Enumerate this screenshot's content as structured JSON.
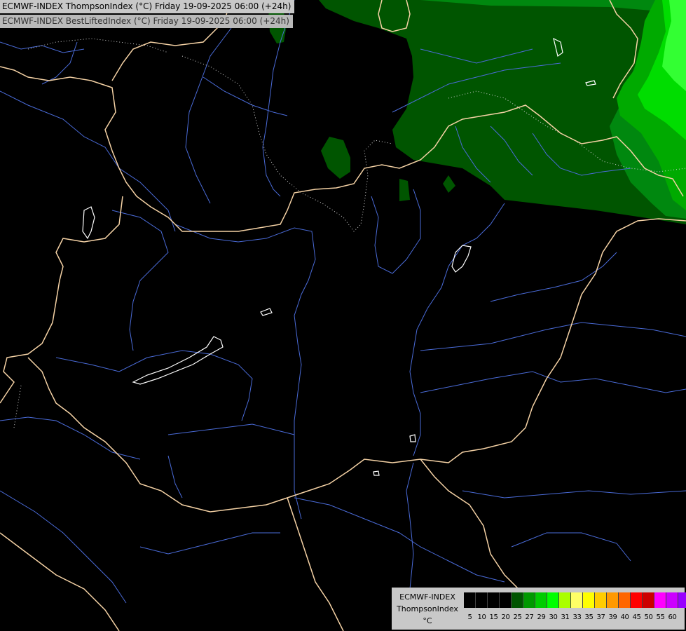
{
  "titles": {
    "line1": "ECMWF-INDEX ThompsonIndex (°C) Friday 19-09-2025 06:00 (+24h)",
    "line2": "ECMWF-INDEX BestLiftedIndex (°C) Friday 19-09-2025 06:00 (+24h)"
  },
  "legend": {
    "model": "ECMWF-INDEX",
    "variable": "ThompsonIndex",
    "unit": "°C",
    "ticks": [
      "5",
      "10",
      "15",
      "20",
      "25",
      "27",
      "29",
      "30",
      "31",
      "33",
      "35",
      "37",
      "39",
      "40",
      "45",
      "50",
      "55",
      "60"
    ],
    "colors": [
      "#000000",
      "#000000",
      "#000000",
      "#000000",
      "#005500",
      "#009900",
      "#00cc00",
      "#00ff00",
      "#aaff00",
      "#ffff66",
      "#ffff00",
      "#ffcc00",
      "#ff9900",
      "#ff6600",
      "#ff0000",
      "#cc0000",
      "#ff00ff",
      "#cc00ff",
      "#9900ff",
      "#6600ff",
      "#0000ff"
    ]
  },
  "map_colors": {
    "background": "#000000",
    "borders": "#f5d2a5",
    "rivers": "#4a6bd8",
    "lakes": "#ffffff",
    "ti_20_25": "#005500",
    "ti_25_27": "#00880f",
    "ti_27_29": "#00aa00",
    "ti_29_30": "#00dd00",
    "ti_30_31": "#33ff33"
  }
}
